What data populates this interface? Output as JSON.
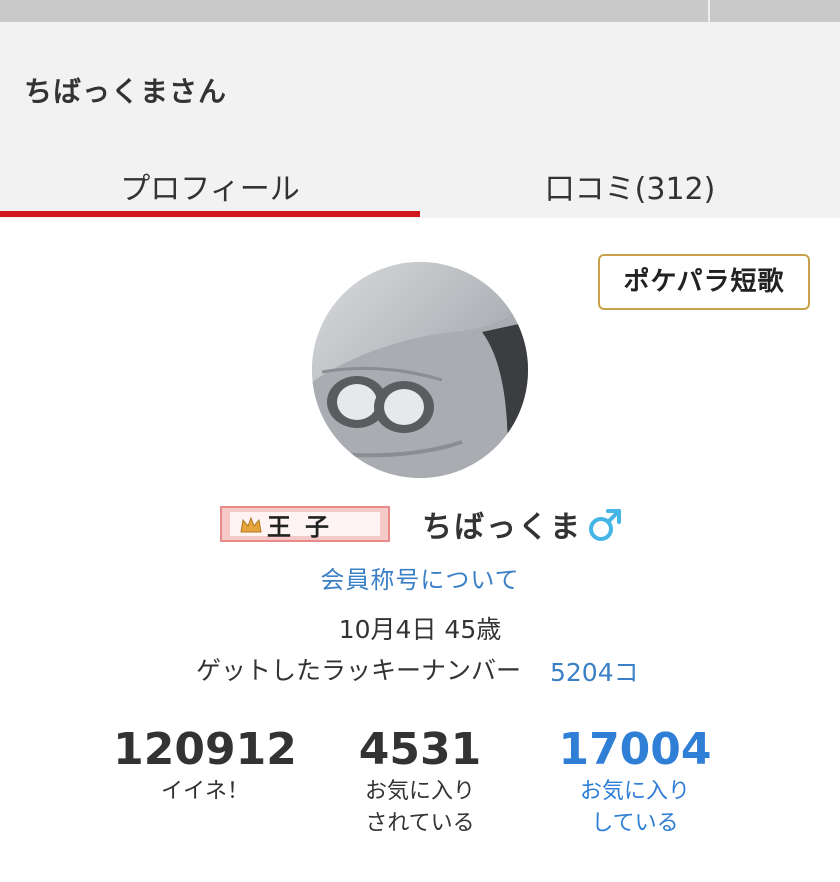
{
  "header": {
    "title": "ちばっくまさん",
    "tabs": [
      {
        "label": "プロフィール",
        "active": true
      },
      {
        "label": "口コミ(312)",
        "active": false
      }
    ],
    "accent_color": "#d0191d"
  },
  "tanka_button": {
    "label": "ポケパラ短歌"
  },
  "profile": {
    "rank_badge": "王子",
    "name": "ちばっくま",
    "gender_icon": "male-symbol-icon",
    "title_link": "会員称号について",
    "birthday": "10月4日 45歳",
    "lucky_label": "ゲットしたラッキーナンバー",
    "lucky_value": "5204コ",
    "link_color": "#3b80c6"
  },
  "stats": [
    {
      "value": "120912",
      "label": "イイネ！"
    },
    {
      "value": "4531",
      "label_line1": "お気に入り",
      "label_line2": "されている"
    },
    {
      "value": "17004",
      "label_line1": "お気に入り",
      "label_line2": "している",
      "color": "#2f7fd6"
    }
  ]
}
